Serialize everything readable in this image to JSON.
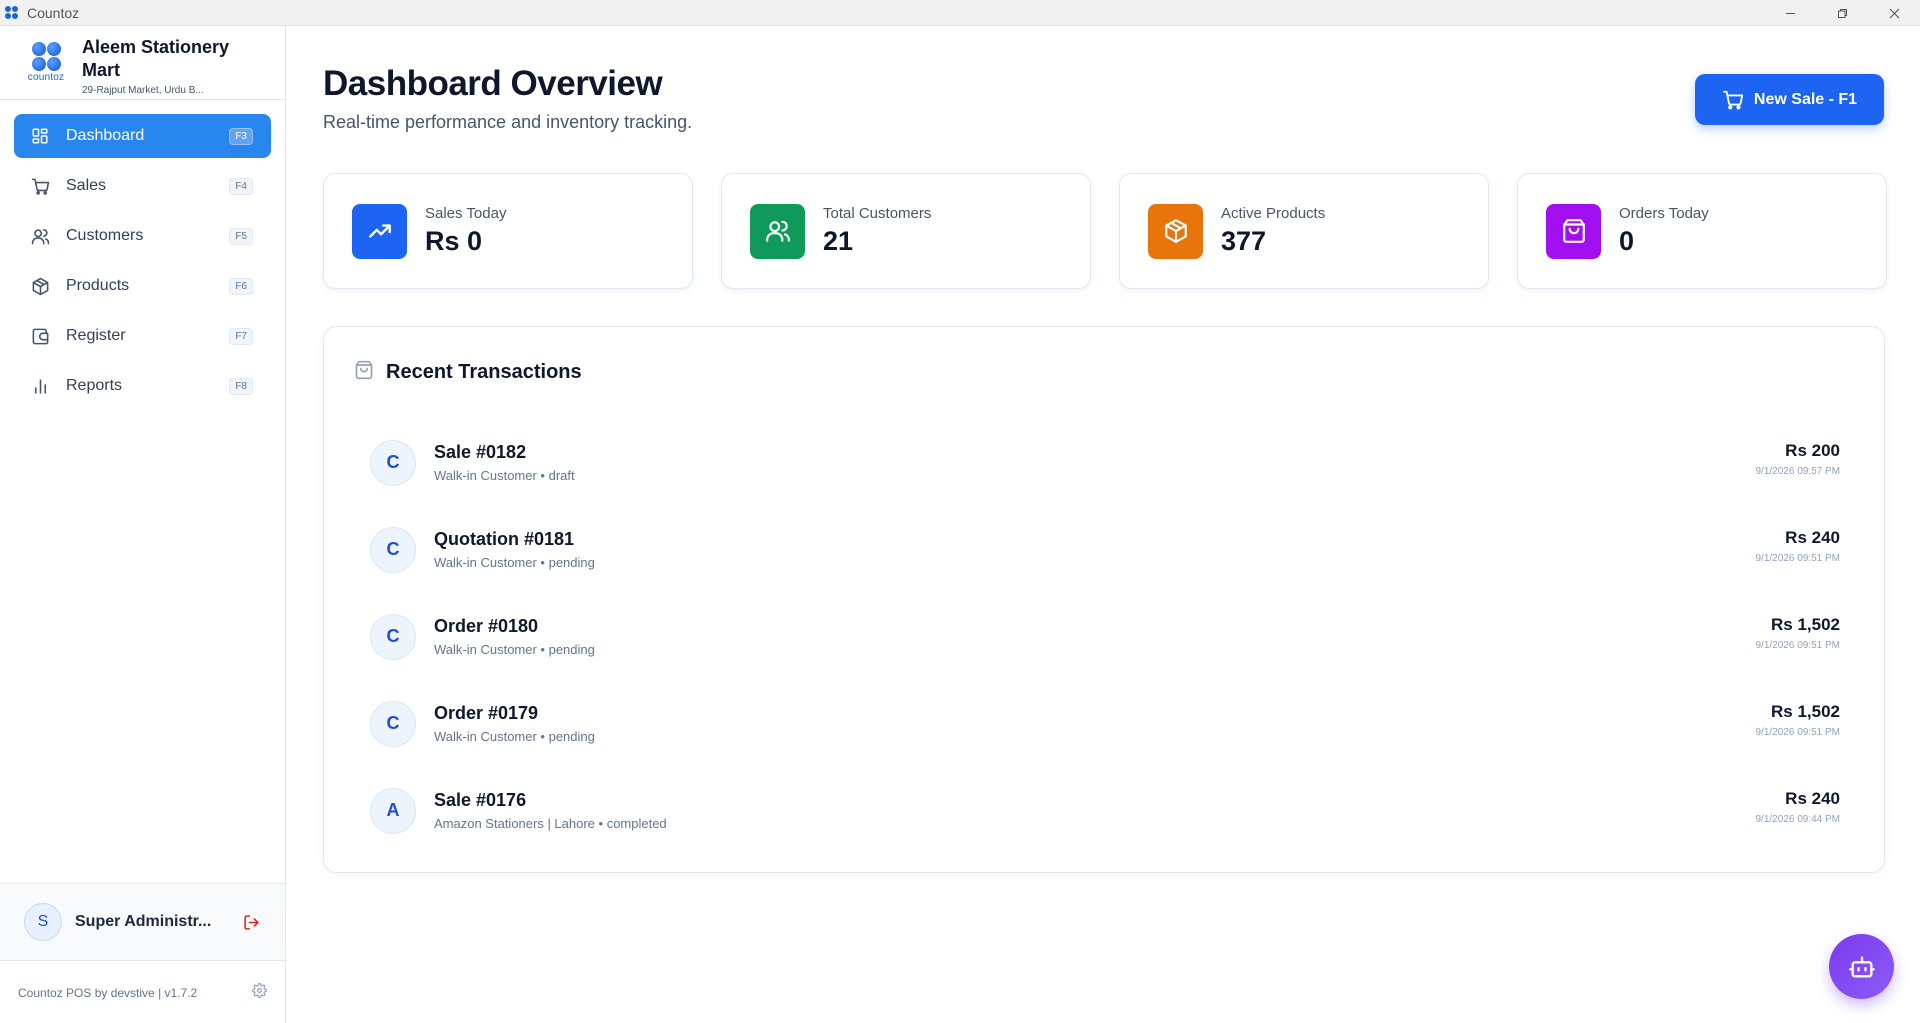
{
  "window": {
    "title": "Countoz"
  },
  "brand": {
    "logo_word": "countoz",
    "name": "Aleem Stationery Mart",
    "address": "29-Rajput Market, Urdu B..."
  },
  "nav": [
    {
      "label": "Dashboard",
      "key": "F3",
      "icon": "dashboard-icon",
      "active": true
    },
    {
      "label": "Sales",
      "key": "F4",
      "icon": "cart-icon"
    },
    {
      "label": "Customers",
      "key": "F5",
      "icon": "users-icon"
    },
    {
      "label": "Products",
      "key": "F6",
      "icon": "box-icon"
    },
    {
      "label": "Register",
      "key": "F7",
      "icon": "wallet-icon"
    },
    {
      "label": "Reports",
      "key": "F8",
      "icon": "bar-chart-icon"
    }
  ],
  "user": {
    "initial": "S",
    "name": "Super Administr..."
  },
  "footer": {
    "text": "Countoz POS by devstive | v1.7.2"
  },
  "header": {
    "title": "Dashboard Overview",
    "subtitle": "Real-time performance and inventory tracking.",
    "new_sale_label": "New Sale - F1"
  },
  "stats": [
    {
      "label": "Sales Today",
      "value": "Rs 0",
      "color": "#1d64f2",
      "icon": "trending-up-icon"
    },
    {
      "label": "Total Customers",
      "value": "21",
      "color": "#0f9a5a",
      "icon": "users-icon"
    },
    {
      "label": "Active Products",
      "value": "377",
      "color": "#e8740c",
      "icon": "box-icon"
    },
    {
      "label": "Orders Today",
      "value": "0",
      "color": "#a10ff0",
      "icon": "shopping-bag-icon"
    }
  ],
  "transactions": {
    "title": "Recent Transactions",
    "items": [
      {
        "initial": "C",
        "name": "Sale #0182",
        "meta": "Walk-in Customer • draft",
        "amount": "Rs 200",
        "time": "9/1/2026 09:57 PM"
      },
      {
        "initial": "C",
        "name": "Quotation #0181",
        "meta": "Walk-in Customer • pending",
        "amount": "Rs 240",
        "time": "9/1/2026 09:51 PM"
      },
      {
        "initial": "C",
        "name": "Order #0180",
        "meta": "Walk-in Customer • pending",
        "amount": "Rs 1,502",
        "time": "9/1/2026 09:51 PM"
      },
      {
        "initial": "C",
        "name": "Order #0179",
        "meta": "Walk-in Customer • pending",
        "amount": "Rs 1,502",
        "time": "9/1/2026 09:51 PM"
      },
      {
        "initial": "A",
        "name": "Sale #0176",
        "meta": "Amazon Stationers | Lahore • completed",
        "amount": "Rs 240",
        "time": "9/1/2026 09:44 PM"
      }
    ]
  }
}
